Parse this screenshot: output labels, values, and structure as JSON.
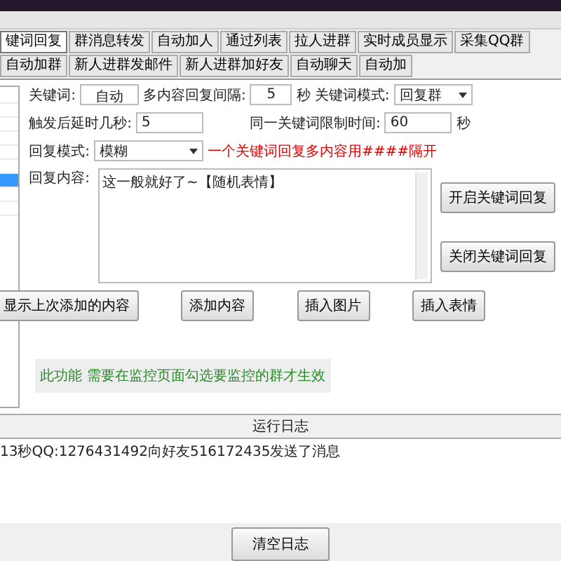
{
  "tabs": [
    {
      "label": "键词回复",
      "selected": true
    },
    {
      "label": "群消息转发",
      "selected": false
    },
    {
      "label": "自动加人",
      "selected": false
    },
    {
      "label": "通过列表",
      "selected": false
    },
    {
      "label": "拉人进群",
      "selected": false
    },
    {
      "label": "实时成员显示",
      "selected": false
    },
    {
      "label": "采集QQ群",
      "selected": false
    },
    {
      "label": "自动加群",
      "selected": false
    },
    {
      "label": "新人进群发邮件",
      "selected": false
    },
    {
      "label": "新人进群加好友",
      "selected": false
    },
    {
      "label": "自动聊天",
      "selected": false
    },
    {
      "label": "自动加",
      "selected": false
    }
  ],
  "left_list": {
    "rows": [
      {
        "selected": false
      },
      {
        "selected": false
      },
      {
        "selected": false
      },
      {
        "selected": false
      },
      {
        "selected": false
      },
      {
        "selected": false
      },
      {
        "selected": true
      },
      {
        "selected": false
      },
      {
        "selected": false
      }
    ]
  },
  "form": {
    "keyword_label": "关键词:",
    "keyword_value": "自动",
    "interval_label": "多内容回复间隔:",
    "interval_value": "5",
    "interval_unit": "秒",
    "mode_label": "关键词模式:",
    "mode_value": "回复群",
    "delay_label": "触发后延时几秒:",
    "delay_value": "5",
    "limit_label": "同一关键词限制时间:",
    "limit_value": "60",
    "limit_unit": "秒",
    "reply_mode_label": "回复模式:",
    "reply_mode_value": "模糊",
    "reply_hint": "一个关键词回复多内容用####隔开",
    "content_label": "回复内容:",
    "content_value": "这一般就好了~【随机表情】"
  },
  "side_buttons": [
    "开启关键词回复",
    "关闭关键词回复"
  ],
  "buttons": [
    "显示上次添加的内容",
    "添加内容",
    "插入图片",
    "插入表情"
  ],
  "notice": "此功能 需要在监控页面勾选要监控的群才生效",
  "log": {
    "title": "运行日志",
    "lines": [
      "13秒QQ:1276431492向好友516172435发送了消息"
    ],
    "clear_button": "清空日志"
  }
}
